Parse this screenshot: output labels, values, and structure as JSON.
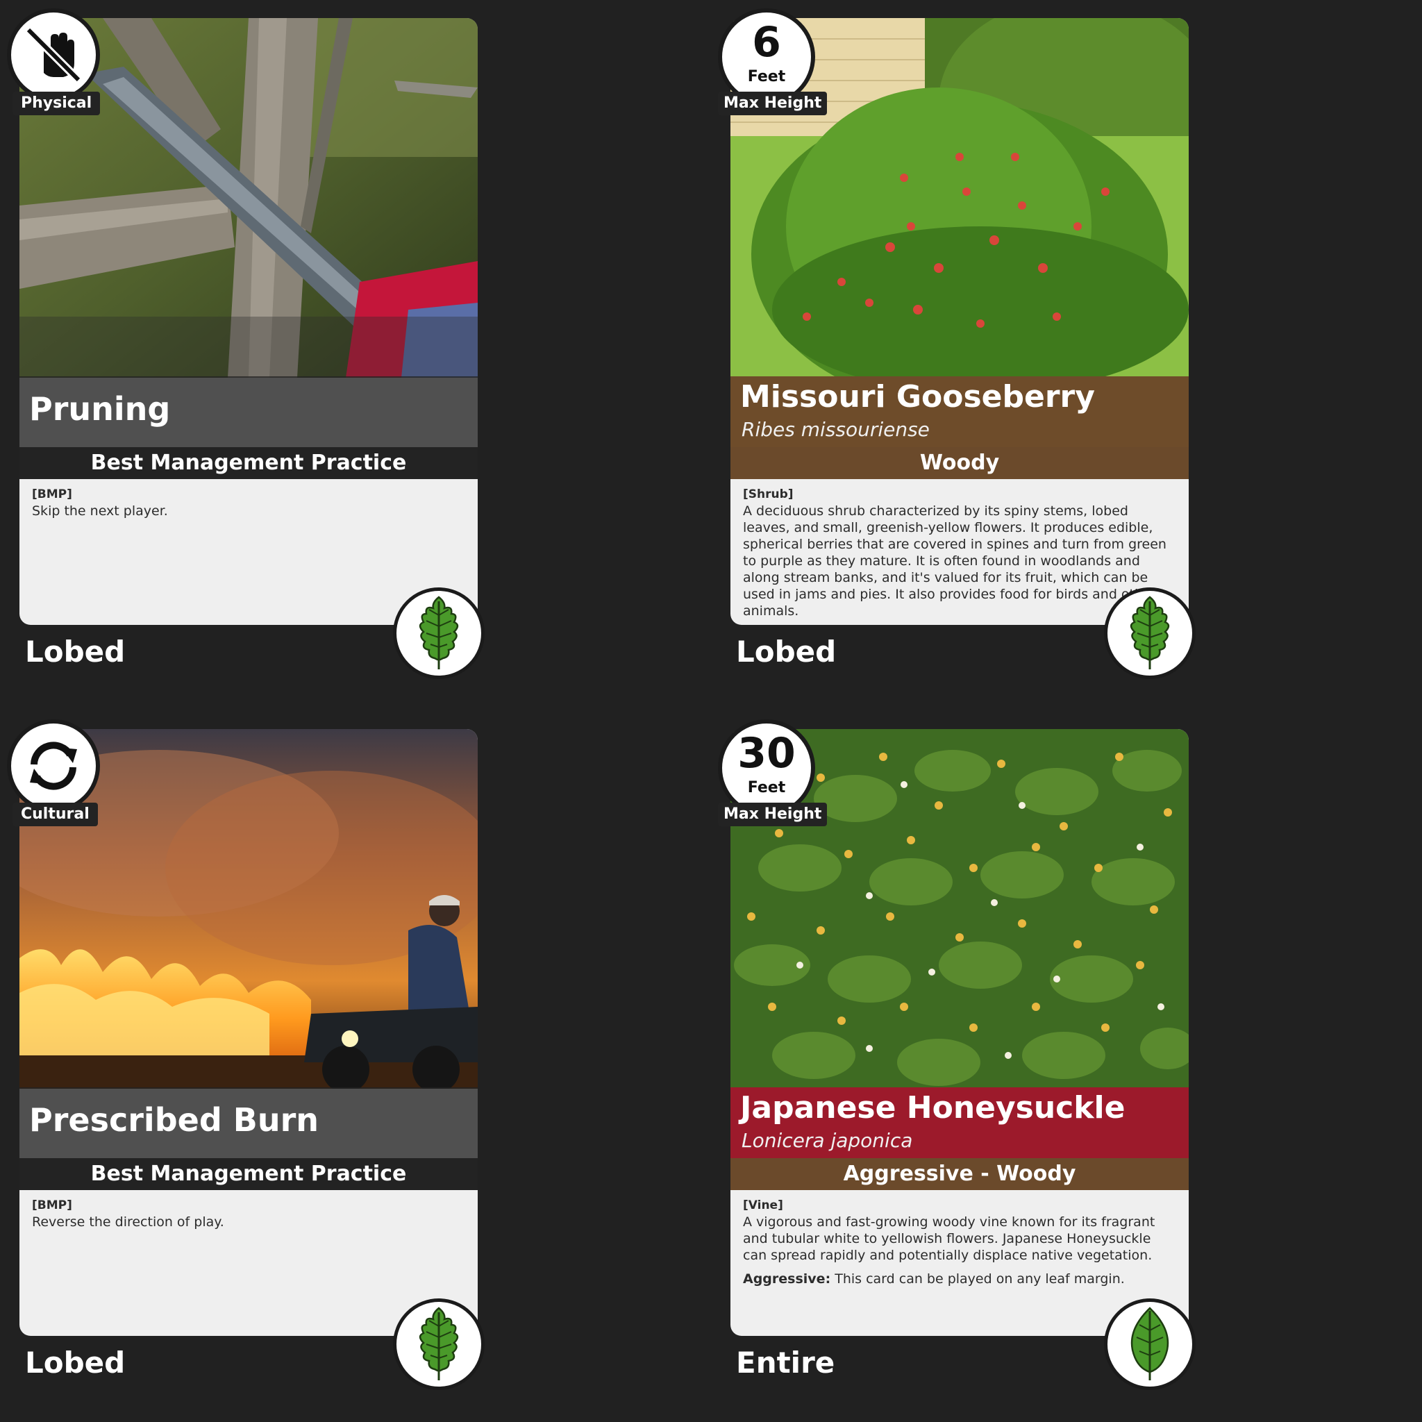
{
  "cards": [
    {
      "kind": "bmp",
      "type_label": "Physical",
      "type_icon": "no-hand-icon",
      "title": "Pruning",
      "subtitle": "Best Management Practice",
      "tag": "[BMP]",
      "description": "Skip the next player.",
      "leaf_margin": "Lobed",
      "leaf_icon": "lobed-leaf-icon",
      "photo": "chainsaw-pruning-branch"
    },
    {
      "kind": "plant",
      "height_value": "6",
      "height_unit": "Feet",
      "height_label": "Max Height",
      "title": "Missouri Gooseberry",
      "latin": "Ribes missouriense",
      "title_band_color": "#6e4c2a",
      "subtitle": "Woody",
      "tag": "[Shrub]",
      "description": "A deciduous shrub characterized by its spiny stems, lobed leaves, and small, greenish-yellow flowers. It produces edible, spherical berries that are covered in spines and turn from green to purple as they mature. It is often found in woodlands and along stream banks, and it's valued for its fruit, which can be used in jams and pies. It also provides food for birds and other animals.",
      "leaf_margin": "Lobed",
      "leaf_icon": "lobed-leaf-icon",
      "photo": "gooseberry-shrub-with-red-berries"
    },
    {
      "kind": "bmp",
      "type_label": "Cultural",
      "type_icon": "cycle-arrows-icon",
      "title": "Prescribed Burn",
      "subtitle": "Best Management Practice",
      "tag": "[BMP]",
      "description": "Reverse the direction of play.",
      "leaf_margin": "Lobed",
      "leaf_icon": "lobed-leaf-icon",
      "photo": "prairie-fire-with-atv"
    },
    {
      "kind": "plant",
      "height_value": "30",
      "height_unit": "Feet",
      "height_label": "Max Height",
      "title": "Japanese Honeysuckle",
      "latin": "Lonicera japonica",
      "title_band_color": "#9c1a2b",
      "subtitle": "Aggressive - Woody",
      "tag": "[Vine]",
      "description": "A vigorous and fast-growing woody vine known for its fragrant and tubular white to yellowish flowers. Japanese Honeysuckle can spread rapidly and potentially displace native vegetation.",
      "aggressive_label": "Aggressive:",
      "aggressive_text": " This card can be played on any leaf margin.",
      "leaf_margin": "Entire",
      "leaf_icon": "entire-leaf-icon",
      "photo": "honeysuckle-hedge-with-flowers"
    }
  ],
  "colors": {
    "background": "#212121",
    "card_text_bg": "#efefef",
    "woody_band": "#6b4a2b",
    "leaf_green": "#4a9a2a"
  }
}
